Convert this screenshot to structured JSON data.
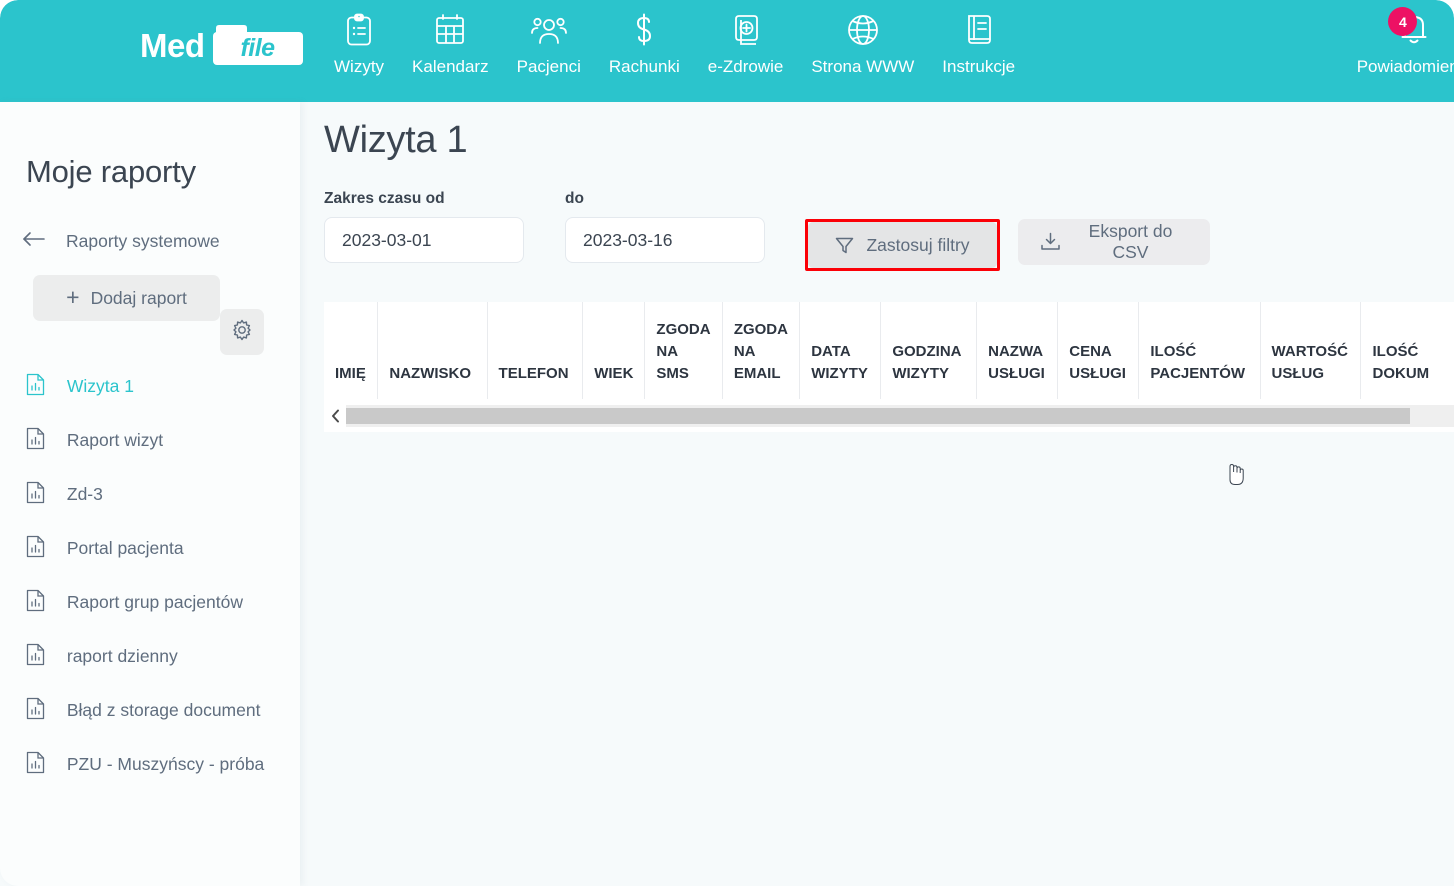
{
  "brand": {
    "med": "Med",
    "file": "file"
  },
  "topnav": {
    "items": [
      {
        "label": "Wizyty",
        "icon": "clipboard-icon"
      },
      {
        "label": "Kalendarz",
        "icon": "calendar-icon"
      },
      {
        "label": "Pacjenci",
        "icon": "people-icon"
      },
      {
        "label": "Rachunki",
        "icon": "dollar-icon"
      },
      {
        "label": "e-Zdrowie",
        "icon": "medical-file-icon"
      },
      {
        "label": "Strona WWW",
        "icon": "globe-icon"
      },
      {
        "label": "Instrukcje",
        "icon": "book-icon"
      }
    ],
    "notifications": {
      "label": "Powiadomienia",
      "count": "4",
      "badge_color": "#ed1164"
    }
  },
  "sidebar": {
    "title": "Moje raporty",
    "system_reports": "Raporty systemowe",
    "add_report": "Dodaj raport",
    "add_report_plus": "+",
    "reports": [
      {
        "label": "Wizyta 1",
        "active": true
      },
      {
        "label": "Raport wizyt",
        "active": false
      },
      {
        "label": "Zd-3",
        "active": false
      },
      {
        "label": "Portal pacjenta",
        "active": false
      },
      {
        "label": "Raport grup pacjentów",
        "active": false
      },
      {
        "label": "raport dzienny",
        "active": false
      },
      {
        "label": "Błąd z storage document",
        "active": false
      },
      {
        "label": "PZU - Muszyńscy - próba",
        "active": false
      }
    ]
  },
  "main": {
    "page_title": "Wizyta 1",
    "filters": {
      "from_label": "Zakres czasu od",
      "from_value": "2023-03-01",
      "to_label": "do",
      "to_value": "2023-03-16",
      "apply_button": "Zastosuj filtry",
      "export_button": "Eksport do CSV",
      "highlight_color": "#fb0007"
    },
    "table": {
      "columns": [
        "IMIĘ",
        "NAZWISKO",
        "TELEFON",
        "WIEK",
        "ZGODA NA SMS",
        "ZGODA NA EMAIL",
        "DATA WIZYTY",
        "GODZINA WIZYTY",
        "NAZWA USŁUGI",
        "CENA USŁUGI",
        "ILOŚĆ PACJENTÓW",
        "WARTOŚĆ USŁUG",
        "ILOŚĆ DOKUM"
      ],
      "rows": []
    }
  },
  "theme": {
    "accent": "#2bc4cc",
    "text": "#3b4551",
    "muted": "#5f6d7e"
  }
}
